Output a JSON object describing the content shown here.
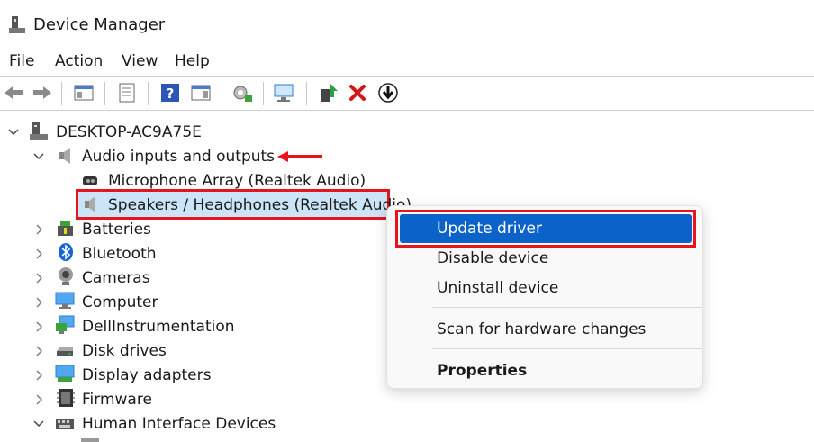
{
  "window": {
    "title": "Device Manager"
  },
  "menu": [
    "File",
    "Action",
    "View",
    "Help"
  ],
  "tree": {
    "root": "DESKTOP-AC9A75E",
    "audio": "Audio inputs and outputs",
    "mic": "Microphone Array (Realtek Audio)",
    "speakers": "Speakers / Headphones (Realtek Audio)",
    "batteries": "Batteries",
    "bluetooth": "Bluetooth",
    "cameras": "Cameras",
    "computer": "Computer",
    "dell": "DellInstrumentation",
    "disk": "Disk drives",
    "display": "Display adapters",
    "firmware": "Firmware",
    "hid": "Human Interface Devices"
  },
  "context_menu": {
    "update": "Update driver",
    "disable": "Disable device",
    "uninstall": "Uninstall device",
    "scan": "Scan for hardware changes",
    "properties": "Properties"
  },
  "colors": {
    "annotation_red": "#e8141b",
    "highlight_blue": "#0b63c9",
    "selection_bg": "#cce4f7"
  }
}
